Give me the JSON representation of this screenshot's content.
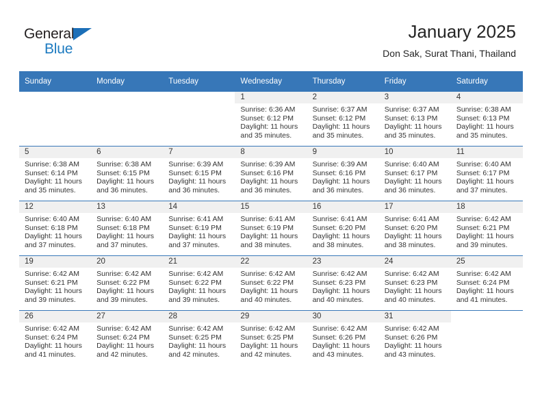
{
  "brand": {
    "name_top": "General",
    "name_bottom": "Blue",
    "triangle_color": "#1c6fb8",
    "blue_text_color": "#1c7ac0"
  },
  "header": {
    "title": "January 2025",
    "subtitle": "Don Sak, Surat Thani, Thailand"
  },
  "colors": {
    "header_row_bg": "#3777b8",
    "header_row_text": "#ffffff",
    "date_bar_bg": "#f0f0f0",
    "cell_bg": "#ffffff",
    "row_divider": "#3777b8",
    "body_text": "#333333"
  },
  "weekday_headers": [
    "Sunday",
    "Monday",
    "Tuesday",
    "Wednesday",
    "Thursday",
    "Friday",
    "Saturday"
  ],
  "weeks": [
    [
      {
        "date": "",
        "sunrise": "",
        "sunset": "",
        "daylight_line1": "",
        "daylight_line2": ""
      },
      {
        "date": "",
        "sunrise": "",
        "sunset": "",
        "daylight_line1": "",
        "daylight_line2": ""
      },
      {
        "date": "",
        "sunrise": "",
        "sunset": "",
        "daylight_line1": "",
        "daylight_line2": ""
      },
      {
        "date": "1",
        "sunrise": "Sunrise: 6:36 AM",
        "sunset": "Sunset: 6:12 PM",
        "daylight_line1": "Daylight: 11 hours",
        "daylight_line2": "and 35 minutes."
      },
      {
        "date": "2",
        "sunrise": "Sunrise: 6:37 AM",
        "sunset": "Sunset: 6:12 PM",
        "daylight_line1": "Daylight: 11 hours",
        "daylight_line2": "and 35 minutes."
      },
      {
        "date": "3",
        "sunrise": "Sunrise: 6:37 AM",
        "sunset": "Sunset: 6:13 PM",
        "daylight_line1": "Daylight: 11 hours",
        "daylight_line2": "and 35 minutes."
      },
      {
        "date": "4",
        "sunrise": "Sunrise: 6:38 AM",
        "sunset": "Sunset: 6:13 PM",
        "daylight_line1": "Daylight: 11 hours",
        "daylight_line2": "and 35 minutes."
      }
    ],
    [
      {
        "date": "5",
        "sunrise": "Sunrise: 6:38 AM",
        "sunset": "Sunset: 6:14 PM",
        "daylight_line1": "Daylight: 11 hours",
        "daylight_line2": "and 35 minutes."
      },
      {
        "date": "6",
        "sunrise": "Sunrise: 6:38 AM",
        "sunset": "Sunset: 6:15 PM",
        "daylight_line1": "Daylight: 11 hours",
        "daylight_line2": "and 36 minutes."
      },
      {
        "date": "7",
        "sunrise": "Sunrise: 6:39 AM",
        "sunset": "Sunset: 6:15 PM",
        "daylight_line1": "Daylight: 11 hours",
        "daylight_line2": "and 36 minutes."
      },
      {
        "date": "8",
        "sunrise": "Sunrise: 6:39 AM",
        "sunset": "Sunset: 6:16 PM",
        "daylight_line1": "Daylight: 11 hours",
        "daylight_line2": "and 36 minutes."
      },
      {
        "date": "9",
        "sunrise": "Sunrise: 6:39 AM",
        "sunset": "Sunset: 6:16 PM",
        "daylight_line1": "Daylight: 11 hours",
        "daylight_line2": "and 36 minutes."
      },
      {
        "date": "10",
        "sunrise": "Sunrise: 6:40 AM",
        "sunset": "Sunset: 6:17 PM",
        "daylight_line1": "Daylight: 11 hours",
        "daylight_line2": "and 36 minutes."
      },
      {
        "date": "11",
        "sunrise": "Sunrise: 6:40 AM",
        "sunset": "Sunset: 6:17 PM",
        "daylight_line1": "Daylight: 11 hours",
        "daylight_line2": "and 37 minutes."
      }
    ],
    [
      {
        "date": "12",
        "sunrise": "Sunrise: 6:40 AM",
        "sunset": "Sunset: 6:18 PM",
        "daylight_line1": "Daylight: 11 hours",
        "daylight_line2": "and 37 minutes."
      },
      {
        "date": "13",
        "sunrise": "Sunrise: 6:40 AM",
        "sunset": "Sunset: 6:18 PM",
        "daylight_line1": "Daylight: 11 hours",
        "daylight_line2": "and 37 minutes."
      },
      {
        "date": "14",
        "sunrise": "Sunrise: 6:41 AM",
        "sunset": "Sunset: 6:19 PM",
        "daylight_line1": "Daylight: 11 hours",
        "daylight_line2": "and 37 minutes."
      },
      {
        "date": "15",
        "sunrise": "Sunrise: 6:41 AM",
        "sunset": "Sunset: 6:19 PM",
        "daylight_line1": "Daylight: 11 hours",
        "daylight_line2": "and 38 minutes."
      },
      {
        "date": "16",
        "sunrise": "Sunrise: 6:41 AM",
        "sunset": "Sunset: 6:20 PM",
        "daylight_line1": "Daylight: 11 hours",
        "daylight_line2": "and 38 minutes."
      },
      {
        "date": "17",
        "sunrise": "Sunrise: 6:41 AM",
        "sunset": "Sunset: 6:20 PM",
        "daylight_line1": "Daylight: 11 hours",
        "daylight_line2": "and 38 minutes."
      },
      {
        "date": "18",
        "sunrise": "Sunrise: 6:42 AM",
        "sunset": "Sunset: 6:21 PM",
        "daylight_line1": "Daylight: 11 hours",
        "daylight_line2": "and 39 minutes."
      }
    ],
    [
      {
        "date": "19",
        "sunrise": "Sunrise: 6:42 AM",
        "sunset": "Sunset: 6:21 PM",
        "daylight_line1": "Daylight: 11 hours",
        "daylight_line2": "and 39 minutes."
      },
      {
        "date": "20",
        "sunrise": "Sunrise: 6:42 AM",
        "sunset": "Sunset: 6:22 PM",
        "daylight_line1": "Daylight: 11 hours",
        "daylight_line2": "and 39 minutes."
      },
      {
        "date": "21",
        "sunrise": "Sunrise: 6:42 AM",
        "sunset": "Sunset: 6:22 PM",
        "daylight_line1": "Daylight: 11 hours",
        "daylight_line2": "and 39 minutes."
      },
      {
        "date": "22",
        "sunrise": "Sunrise: 6:42 AM",
        "sunset": "Sunset: 6:22 PM",
        "daylight_line1": "Daylight: 11 hours",
        "daylight_line2": "and 40 minutes."
      },
      {
        "date": "23",
        "sunrise": "Sunrise: 6:42 AM",
        "sunset": "Sunset: 6:23 PM",
        "daylight_line1": "Daylight: 11 hours",
        "daylight_line2": "and 40 minutes."
      },
      {
        "date": "24",
        "sunrise": "Sunrise: 6:42 AM",
        "sunset": "Sunset: 6:23 PM",
        "daylight_line1": "Daylight: 11 hours",
        "daylight_line2": "and 40 minutes."
      },
      {
        "date": "25",
        "sunrise": "Sunrise: 6:42 AM",
        "sunset": "Sunset: 6:24 PM",
        "daylight_line1": "Daylight: 11 hours",
        "daylight_line2": "and 41 minutes."
      }
    ],
    [
      {
        "date": "26",
        "sunrise": "Sunrise: 6:42 AM",
        "sunset": "Sunset: 6:24 PM",
        "daylight_line1": "Daylight: 11 hours",
        "daylight_line2": "and 41 minutes."
      },
      {
        "date": "27",
        "sunrise": "Sunrise: 6:42 AM",
        "sunset": "Sunset: 6:24 PM",
        "daylight_line1": "Daylight: 11 hours",
        "daylight_line2": "and 42 minutes."
      },
      {
        "date": "28",
        "sunrise": "Sunrise: 6:42 AM",
        "sunset": "Sunset: 6:25 PM",
        "daylight_line1": "Daylight: 11 hours",
        "daylight_line2": "and 42 minutes."
      },
      {
        "date": "29",
        "sunrise": "Sunrise: 6:42 AM",
        "sunset": "Sunset: 6:25 PM",
        "daylight_line1": "Daylight: 11 hours",
        "daylight_line2": "and 42 minutes."
      },
      {
        "date": "30",
        "sunrise": "Sunrise: 6:42 AM",
        "sunset": "Sunset: 6:26 PM",
        "daylight_line1": "Daylight: 11 hours",
        "daylight_line2": "and 43 minutes."
      },
      {
        "date": "31",
        "sunrise": "Sunrise: 6:42 AM",
        "sunset": "Sunset: 6:26 PM",
        "daylight_line1": "Daylight: 11 hours",
        "daylight_line2": "and 43 minutes."
      },
      {
        "date": "",
        "sunrise": "",
        "sunset": "",
        "daylight_line1": "",
        "daylight_line2": ""
      }
    ]
  ]
}
